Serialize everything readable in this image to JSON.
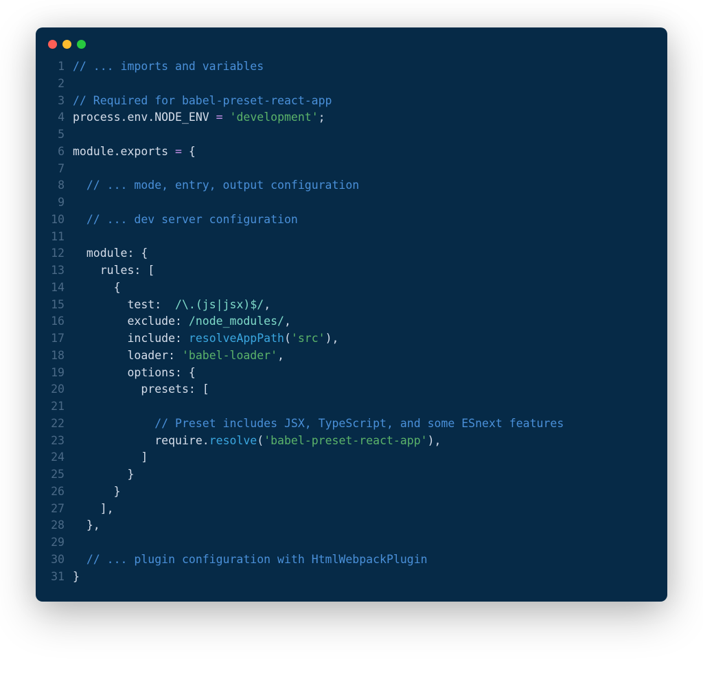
{
  "window": {
    "traffic_lights": [
      "red",
      "yellow",
      "green"
    ]
  },
  "code": {
    "lines": [
      {
        "n": 1,
        "tokens": [
          {
            "c": "tok-comment",
            "t": "// ... imports and variables"
          }
        ]
      },
      {
        "n": 2,
        "tokens": []
      },
      {
        "n": 3,
        "tokens": [
          {
            "c": "tok-comment",
            "t": "// Required for babel-preset-react-app"
          }
        ]
      },
      {
        "n": 4,
        "tokens": [
          {
            "c": "tok-ident",
            "t": "process"
          },
          {
            "c": "tok-punct",
            "t": "."
          },
          {
            "c": "tok-ident",
            "t": "env"
          },
          {
            "c": "tok-punct",
            "t": "."
          },
          {
            "c": "tok-ident",
            "t": "NODE_ENV"
          },
          {
            "c": "tok-op",
            "t": " = "
          },
          {
            "c": "tok-string",
            "t": "'development'"
          },
          {
            "c": "tok-punct",
            "t": ";"
          }
        ]
      },
      {
        "n": 5,
        "tokens": []
      },
      {
        "n": 6,
        "tokens": [
          {
            "c": "tok-ident",
            "t": "module"
          },
          {
            "c": "tok-punct",
            "t": "."
          },
          {
            "c": "tok-ident",
            "t": "exports"
          },
          {
            "c": "tok-op",
            "t": " = "
          },
          {
            "c": "tok-punct",
            "t": "{"
          }
        ]
      },
      {
        "n": 7,
        "tokens": []
      },
      {
        "n": 8,
        "tokens": [
          {
            "c": "tok-ident",
            "t": "  "
          },
          {
            "c": "tok-comment",
            "t": "// ... mode, entry, output configuration"
          }
        ]
      },
      {
        "n": 9,
        "tokens": []
      },
      {
        "n": 10,
        "tokens": [
          {
            "c": "tok-ident",
            "t": "  "
          },
          {
            "c": "tok-comment",
            "t": "// ... dev server configuration"
          }
        ]
      },
      {
        "n": 11,
        "tokens": []
      },
      {
        "n": 12,
        "tokens": [
          {
            "c": "tok-ident",
            "t": "  "
          },
          {
            "c": "tok-prop",
            "t": "module"
          },
          {
            "c": "tok-punct",
            "t": ": {"
          }
        ]
      },
      {
        "n": 13,
        "tokens": [
          {
            "c": "tok-ident",
            "t": "    "
          },
          {
            "c": "tok-prop",
            "t": "rules"
          },
          {
            "c": "tok-punct",
            "t": ": ["
          }
        ]
      },
      {
        "n": 14,
        "tokens": [
          {
            "c": "tok-ident",
            "t": "      "
          },
          {
            "c": "tok-punct",
            "t": "{"
          }
        ]
      },
      {
        "n": 15,
        "tokens": [
          {
            "c": "tok-ident",
            "t": "        "
          },
          {
            "c": "tok-prop",
            "t": "test"
          },
          {
            "c": "tok-punct",
            "t": ":  "
          },
          {
            "c": "tok-regex",
            "t": "/\\.(js|jsx)$/"
          },
          {
            "c": "tok-punct",
            "t": ","
          }
        ]
      },
      {
        "n": 16,
        "tokens": [
          {
            "c": "tok-ident",
            "t": "        "
          },
          {
            "c": "tok-prop",
            "t": "exclude"
          },
          {
            "c": "tok-punct",
            "t": ": "
          },
          {
            "c": "tok-regex",
            "t": "/node_modules/"
          },
          {
            "c": "tok-punct",
            "t": ","
          }
        ]
      },
      {
        "n": 17,
        "tokens": [
          {
            "c": "tok-ident",
            "t": "        "
          },
          {
            "c": "tok-prop",
            "t": "include"
          },
          {
            "c": "tok-punct",
            "t": ": "
          },
          {
            "c": "tok-fn",
            "t": "resolveAppPath"
          },
          {
            "c": "tok-punct",
            "t": "("
          },
          {
            "c": "tok-string",
            "t": "'src'"
          },
          {
            "c": "tok-punct",
            "t": "),"
          }
        ]
      },
      {
        "n": 18,
        "tokens": [
          {
            "c": "tok-ident",
            "t": "        "
          },
          {
            "c": "tok-prop",
            "t": "loader"
          },
          {
            "c": "tok-punct",
            "t": ": "
          },
          {
            "c": "tok-string",
            "t": "'babel-loader'"
          },
          {
            "c": "tok-punct",
            "t": ","
          }
        ]
      },
      {
        "n": 19,
        "tokens": [
          {
            "c": "tok-ident",
            "t": "        "
          },
          {
            "c": "tok-prop",
            "t": "options"
          },
          {
            "c": "tok-punct",
            "t": ": {"
          }
        ]
      },
      {
        "n": 20,
        "tokens": [
          {
            "c": "tok-ident",
            "t": "          "
          },
          {
            "c": "tok-prop",
            "t": "presets"
          },
          {
            "c": "tok-punct",
            "t": ": ["
          }
        ]
      },
      {
        "n": 21,
        "tokens": []
      },
      {
        "n": 22,
        "tokens": [
          {
            "c": "tok-ident",
            "t": "            "
          },
          {
            "c": "tok-comment",
            "t": "// Preset includes JSX, TypeScript, and some ESnext features"
          }
        ]
      },
      {
        "n": 23,
        "tokens": [
          {
            "c": "tok-ident",
            "t": "            "
          },
          {
            "c": "tok-ident",
            "t": "require"
          },
          {
            "c": "tok-punct",
            "t": "."
          },
          {
            "c": "tok-fn",
            "t": "resolve"
          },
          {
            "c": "tok-punct",
            "t": "("
          },
          {
            "c": "tok-string",
            "t": "'babel-preset-react-app'"
          },
          {
            "c": "tok-punct",
            "t": "),"
          }
        ]
      },
      {
        "n": 24,
        "tokens": [
          {
            "c": "tok-ident",
            "t": "          "
          },
          {
            "c": "tok-punct",
            "t": "]"
          }
        ]
      },
      {
        "n": 25,
        "tokens": [
          {
            "c": "tok-ident",
            "t": "        "
          },
          {
            "c": "tok-punct",
            "t": "}"
          }
        ]
      },
      {
        "n": 26,
        "tokens": [
          {
            "c": "tok-ident",
            "t": "      "
          },
          {
            "c": "tok-punct",
            "t": "}"
          }
        ]
      },
      {
        "n": 27,
        "tokens": [
          {
            "c": "tok-ident",
            "t": "    "
          },
          {
            "c": "tok-punct",
            "t": "],"
          }
        ]
      },
      {
        "n": 28,
        "tokens": [
          {
            "c": "tok-ident",
            "t": "  "
          },
          {
            "c": "tok-punct",
            "t": "},"
          }
        ]
      },
      {
        "n": 29,
        "tokens": []
      },
      {
        "n": 30,
        "tokens": [
          {
            "c": "tok-ident",
            "t": "  "
          },
          {
            "c": "tok-comment",
            "t": "// ... plugin configuration with HtmlWebpackPlugin"
          }
        ]
      },
      {
        "n": 31,
        "tokens": [
          {
            "c": "tok-punct",
            "t": "}"
          }
        ]
      }
    ]
  }
}
